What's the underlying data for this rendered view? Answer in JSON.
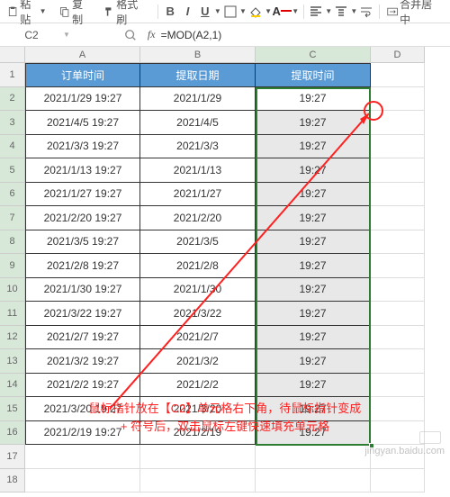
{
  "toolbar": {
    "paste": "粘贴",
    "copy": "复制",
    "format_painter": "格式刷",
    "merge_center": "合并居中"
  },
  "formula_bar": {
    "cell_ref": "C2",
    "formula": "=MOD(A2,1)"
  },
  "columns": [
    "A",
    "B",
    "C",
    "D"
  ],
  "headers": {
    "a": "订单时间",
    "b": "提取日期",
    "c": "提取时间"
  },
  "rows": [
    {
      "n": "2",
      "a": "2021/1/29 19:27",
      "b": "2021/1/29",
      "c": "19:27"
    },
    {
      "n": "3",
      "a": "2021/4/5 19:27",
      "b": "2021/4/5",
      "c": "19:27"
    },
    {
      "n": "4",
      "a": "2021/3/3 19:27",
      "b": "2021/3/3",
      "c": "19:27"
    },
    {
      "n": "5",
      "a": "2021/1/13 19:27",
      "b": "2021/1/13",
      "c": "19:27"
    },
    {
      "n": "6",
      "a": "2021/1/27 19:27",
      "b": "2021/1/27",
      "c": "19:27"
    },
    {
      "n": "7",
      "a": "2021/2/20 19:27",
      "b": "2021/2/20",
      "c": "19:27"
    },
    {
      "n": "8",
      "a": "2021/3/5 19:27",
      "b": "2021/3/5",
      "c": "19:27"
    },
    {
      "n": "9",
      "a": "2021/2/8 19:27",
      "b": "2021/2/8",
      "c": "19:27"
    },
    {
      "n": "10",
      "a": "2021/1/30 19:27",
      "b": "2021/1/30",
      "c": "19:27"
    },
    {
      "n": "11",
      "a": "2021/3/22 19:27",
      "b": "2021/3/22",
      "c": "19:27"
    },
    {
      "n": "12",
      "a": "2021/2/7 19:27",
      "b": "2021/2/7",
      "c": "19:27"
    },
    {
      "n": "13",
      "a": "2021/3/2 19:27",
      "b": "2021/3/2",
      "c": "19:27"
    },
    {
      "n": "14",
      "a": "2021/2/2 19:27",
      "b": "2021/2/2",
      "c": "19:27"
    },
    {
      "n": "15",
      "a": "2021/3/20 19:27",
      "b": "2021/3/20",
      "c": "19:27"
    },
    {
      "n": "16",
      "a": "2021/2/19 19:27",
      "b": "2021/2/19",
      "c": "19:27"
    }
  ],
  "empty_rows": [
    "17",
    "18"
  ],
  "annotation": {
    "line1": "鼠标指针放在【C2】单元格右下角，待鼠标指针变成",
    "line2": "+ 符号后，双击鼠标左键快速填充单元格"
  },
  "watermark": "jingyan.baidu.com"
}
